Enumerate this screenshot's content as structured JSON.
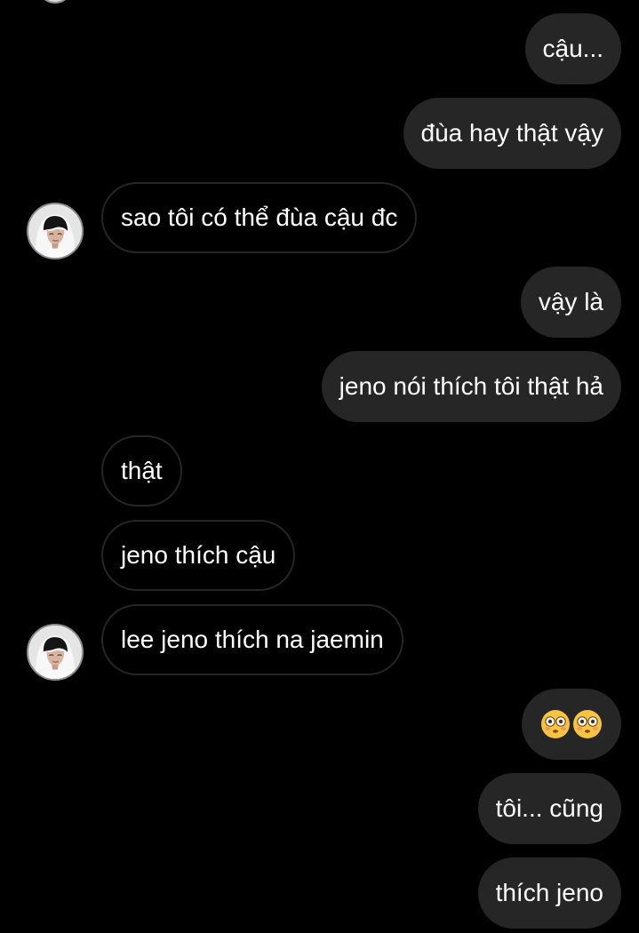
{
  "conversation": {
    "messages": [
      {
        "text": "cậu..."
      },
      {
        "text": "đùa hay thật vậy"
      },
      {
        "text": "sao tôi có thể đùa cậu đc"
      },
      {
        "text": "vậy là"
      },
      {
        "text": "jeno nói thích tôi thật hả"
      },
      {
        "text": "thật"
      },
      {
        "text": "jeno thích cậu"
      },
      {
        "text": "lee jeno thích na jaemin"
      },
      {
        "text": "tôi... cũng"
      },
      {
        "text": "thích jeno"
      }
    ],
    "emoji_message": {
      "icon_name": "flushed-face-icon",
      "count": 2
    }
  },
  "theme": {
    "background": "#000000",
    "outgoing_bubble": "#262626",
    "incoming_border": "#262626",
    "text": "#ffffff"
  }
}
